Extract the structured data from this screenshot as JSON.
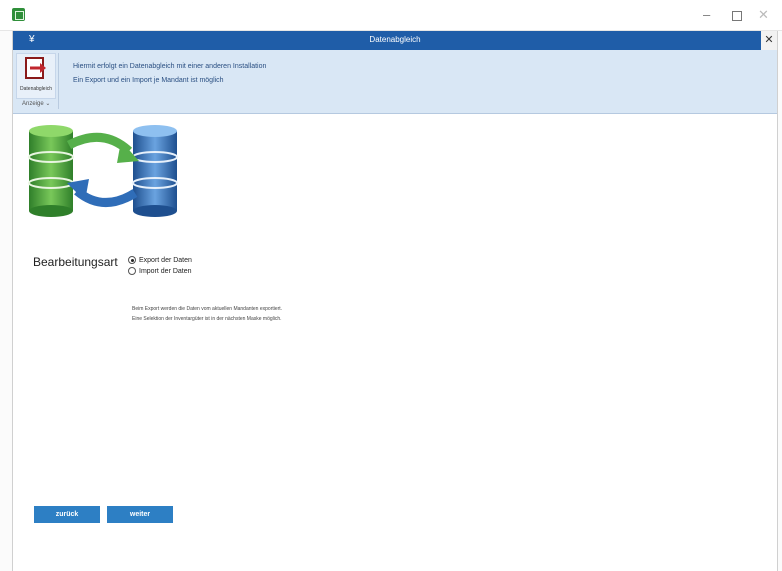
{
  "window": {
    "controls": {
      "minimize": "–",
      "close": "✕"
    }
  },
  "dialog": {
    "logo": "¥",
    "title": "Datenabgleich",
    "close": "✕"
  },
  "ribbon": {
    "button_label": "Datenabgleich",
    "group_label": "Anzeige ⌄",
    "info_line_1": "Hiermit erfolgt ein Datenabgleich mit einer anderen Installation",
    "info_line_2": "Ein Export und ein Import je Mandant ist möglich"
  },
  "form": {
    "label": "Bearbeitungsart",
    "options": [
      {
        "label": "Export der Daten",
        "selected": true
      },
      {
        "label": "Import  der Daten",
        "selected": false
      }
    ],
    "description_line_1": "Beim Export werden die Daten vom aktuellen Mandanten exportiert.",
    "description_line_2": "Eine Selektion der Inventargüter ist in der nächsten Maske möglich."
  },
  "buttons": {
    "back": "zurück",
    "next": "weiter"
  },
  "colors": {
    "header_blue": "#1f5da8",
    "ribbon_bg": "#d9e7f5",
    "button_blue": "#2d7fc4",
    "db_green": "#56b04a",
    "db_blue": "#2f6db8"
  }
}
